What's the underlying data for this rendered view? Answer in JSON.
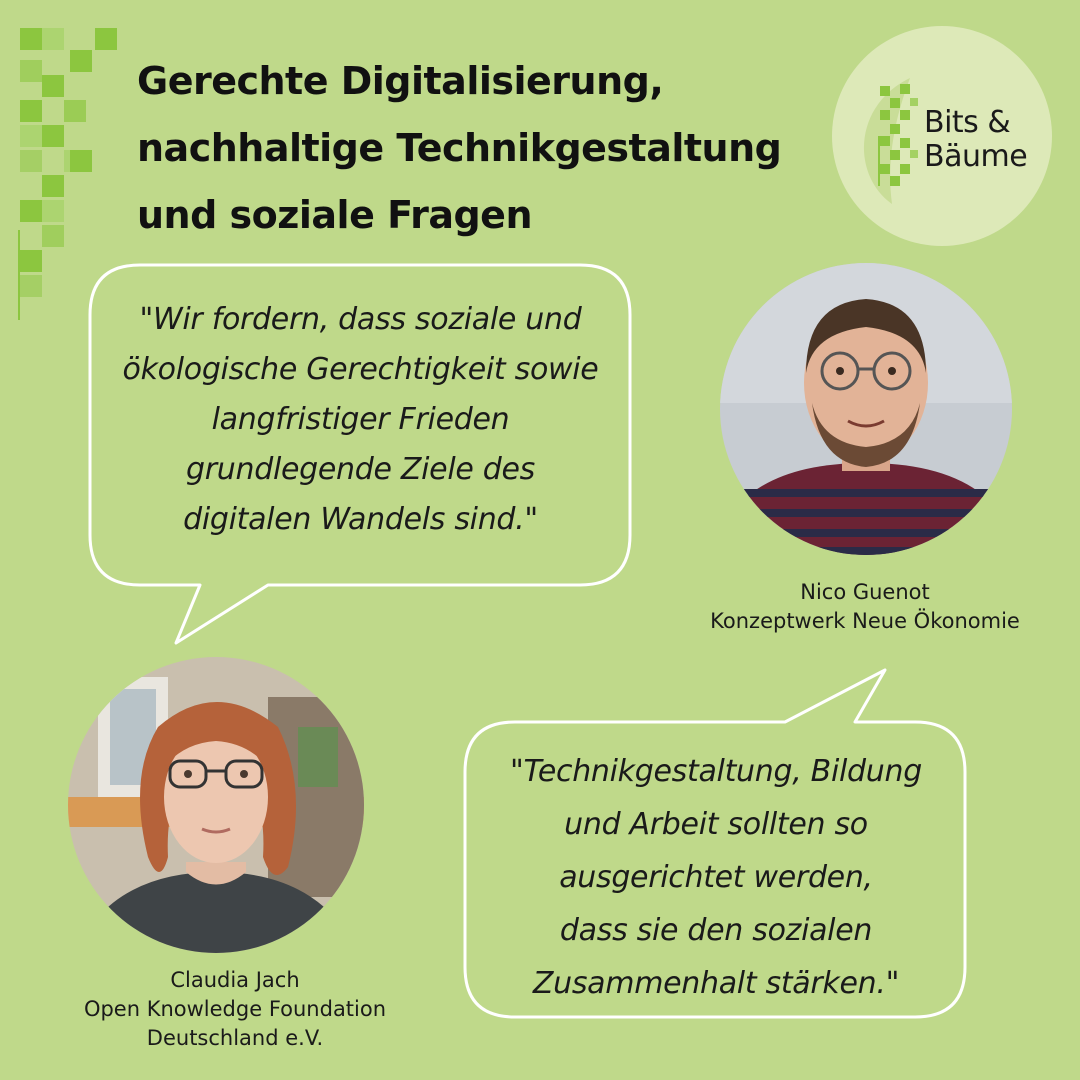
{
  "title": {
    "line1": "Gerechte Digitalisierung,",
    "line2": "nachhaltige Technikgestaltung",
    "line3": "und soziale Fragen"
  },
  "logo": {
    "line1": "Bits &",
    "line2": "Bäume",
    "icon": "leaf-pixel-icon"
  },
  "quote1": {
    "lines": [
      "\"Wir fordern, dass soziale und",
      "ökologische Gerechtigkeit sowie",
      "langfristiger Frieden",
      "grundlegende Ziele des",
      "digitalen Wandels sind.\""
    ]
  },
  "quote2": {
    "lines": [
      "\"Technikgestaltung, Bildung",
      "und Arbeit sollten so",
      "ausgerichtet werden,",
      "dass sie den sozialen",
      "Zusammenhalt stärken.\""
    ]
  },
  "speaker1": {
    "name": "Nico Guenot",
    "org": "Konzeptwerk Neue Ökonomie"
  },
  "speaker2": {
    "name": "Claudia Jach",
    "org_line1": "Open Knowledge Foundation",
    "org_line2": "Deutschland e.V."
  },
  "colors": {
    "background": "#bfd98a",
    "accent_pixels": "#8cc63f",
    "logo_circle": "#dde9b8",
    "bubble_stroke": "#ffffff"
  }
}
